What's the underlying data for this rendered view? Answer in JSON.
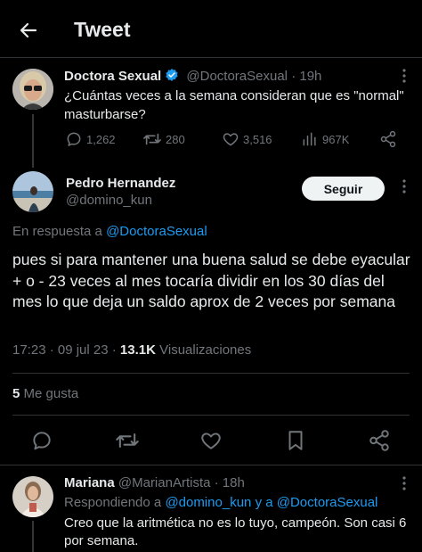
{
  "header": {
    "title": "Tweet"
  },
  "parent_tweet": {
    "display_name": "Doctora Sexual",
    "handle": "@DoctoraSexual",
    "time": "· 19h",
    "text": "¿Cuántas veces a la semana consideran que es \"normal\" masturbarse?",
    "replies": "1,262",
    "retweets": "280",
    "likes": "3,516",
    "views": "967K"
  },
  "main_tweet": {
    "display_name": "Pedro Hernandez",
    "handle": "@domino_kun",
    "follow_label": "Seguir",
    "reply_prefix": "En respuesta a",
    "reply_to": "@DoctoraSexual",
    "text": "pues si para mantener una buena salud se debe eyacular + o - 23 veces al mes tocaría dividir en los 30 días del mes lo que deja un saldo aprox de 2 veces por semana",
    "timestamp": "17:23 · 09 jul 23 ·",
    "views_count": "13.1K",
    "views_label": "Visualizaciones",
    "likes_count": "5",
    "likes_label": "Me gusta"
  },
  "reply_tweet": {
    "display_name": "Mariana",
    "handle": "@MarianArtista",
    "time": "· 18h",
    "reply_prefix": "Respondiendo a",
    "reply_to_1": "@domino_kun",
    "reply_joiner": "y a",
    "reply_to_2": "@DoctoraSexual",
    "text": "Creo que la aritmética no es lo tuyo, campeón. Son casi 6 por semana."
  },
  "colors": {
    "accent": "#1d9bf0",
    "muted": "#71767b",
    "text": "#e7e9ea",
    "background": "#000000"
  }
}
